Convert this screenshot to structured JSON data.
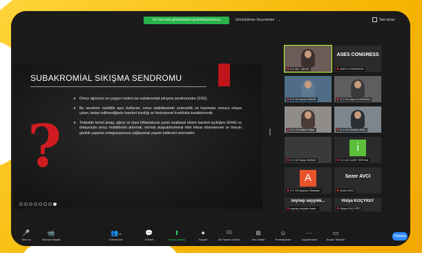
{
  "topbar": {
    "recording_text": "ch'ı tal rame görüntüsünü görüntülüyorsunuz",
    "view_options": "Görüntüleme Seçenekleri",
    "view_chevron": "⌄",
    "fullscreen": "Tam ekran"
  },
  "slide": {
    "title": "SUBAKROMİAL SIKIŞMA SENDROMU",
    "question_mark": "?",
    "bullets": [
      "Omuz ağrısının en yaygın nedeni ise subakromial sıkışma sendromudur (SSS).",
      "Bu sendrom özellikle aşırı kullanım, omuz stabilitesinde yetersizlik ve travmalar sonucu ortaya çıkan, tedavi edilmediğinde hareket kısıtlığı ve fonksiyonel kısıtlılıkla karakterizedir.",
      "Tedavide temel amaç; ağrıyı ve olası inflamatuvar yanıtı azaltarak eklem hareket açıklığını (EHA) ve dolayısıyla omuz mobilitesini artırmak, normal skapulohumeral ritmi tekrar düzenlemek ve bireyin günlük yaşama entegrasyonunu sağlayarak yaşam kalitesini artırmaktır."
    ],
    "bullet_glyph": "➤"
  },
  "gallery": {
    "tiles": [
      {
        "big": "",
        "name": "S.1 Nil... ÇELİK"
      },
      {
        "big": "ASES CONGRESS",
        "name": "ASES CONGRESS"
      },
      {
        "big": "",
        "name": "S.1 H2 Murat DEMİR"
      },
      {
        "big": "",
        "name": "S.1 H2 Adem KORKMAZ"
      },
      {
        "big": "",
        "name": "S.1 H2 Hatice Güler"
      },
      {
        "big": "",
        "name": "S.1 H2 Hüseyin AŞIK"
      },
      {
        "big": "",
        "name": "S.1 H2 Sude GÜRAY"
      },
      {
        "big": "i",
        "name": "S.1 H2 İLKER TERYAK"
      },
      {
        "big": "A",
        "name": "S.1 H2 Ayşenur Balaban"
      },
      {
        "big": "Sezer AVCI",
        "name": "Sezer AVCI"
      },
      {
        "big": "zeynep  seyyide...",
        "name": "zeynep seyyide bask..."
      },
      {
        "big": "Hülya KOÇYİĞİT",
        "name": "Hülya KOÇYİĞİT"
      }
    ]
  },
  "toolbar": {
    "items": [
      {
        "icon": "🎤",
        "label": "Sesi aç"
      },
      {
        "icon": "📹",
        "label": "Videoyu Başlat"
      },
      {
        "icon": "👥",
        "label": "Katılımcılar",
        "count": "12"
      },
      {
        "icon": "💬",
        "label": "Sohbet"
      },
      {
        "icon": "⬆",
        "label": "Ekranı paylaş"
      },
      {
        "icon": "⏺",
        "label": "Kaydet"
      },
      {
        "icon": "CC",
        "label": "Alt Yazıları Göster"
      },
      {
        "icon": "⊞",
        "label": "Ara Odalar"
      },
      {
        "icon": "☺",
        "label": "Reaksiyonlar"
      },
      {
        "icon": "⋯",
        "label": "Uygulamalar"
      },
      {
        "icon": "▭",
        "label": "Beyaz Tahtalar"
      }
    ],
    "end_label": "Odadan"
  },
  "colors": {
    "frame": "#f5b400",
    "slide_accent": "#c0151a",
    "share_green": "#2ccf63",
    "recording_green": "#29b34a",
    "end_blue": "#2d8cff"
  }
}
